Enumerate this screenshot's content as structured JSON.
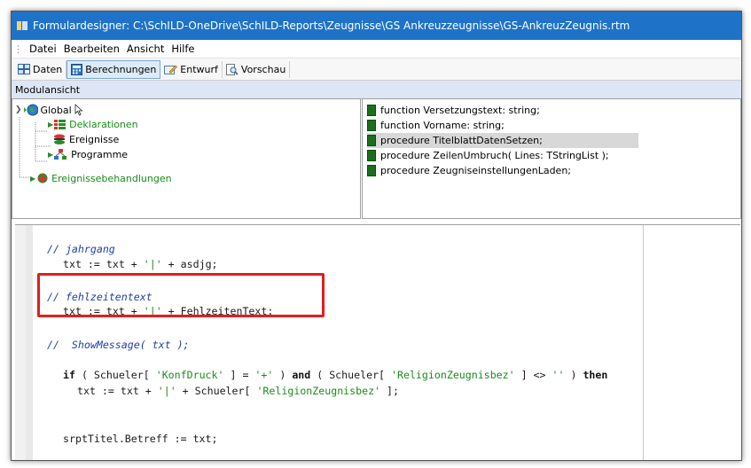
{
  "window": {
    "title": "Formulardesigner: C:\\SchILD-OneDrive\\SchILD-Reports\\Zeugnisse\\GS Ankreuzzeugnisse\\GS-AnkreuzZeugnis.rtm"
  },
  "menu": [
    "Datei",
    "Bearbeiten",
    "Ansicht",
    "Hilfe"
  ],
  "toolbar": {
    "tabs": [
      {
        "label": "Daten",
        "icon": "data-grid-icon"
      },
      {
        "label": "Berechnungen",
        "icon": "calculator-icon"
      },
      {
        "label": "Entwurf",
        "icon": "design-pencil-icon"
      },
      {
        "label": "Vorschau",
        "icon": "preview-magnifier-icon"
      }
    ]
  },
  "module_header": "Modulansicht",
  "tree": {
    "global": "Global",
    "deklarationen": "Deklarationen",
    "ereignisse": "Ereignisse",
    "programme": "Programme",
    "ereignisbehandlungen": "Ereignissebehandlungen"
  },
  "procedures": [
    "function Versetzungstext: string;",
    "function Vorname: string;",
    "procedure TitelblattDatenSetzen;",
    "procedure ZeilenUmbruch( Lines: TStringList );",
    "procedure ZeugniseinstellungenLaden;"
  ],
  "selected_procedure_index": 2,
  "code": {
    "l1_comment": "// jahrgang",
    "l2_a": "txt := txt + ",
    "l2_str": "'|'",
    "l2_b": " + asdjg;",
    "l3_comment": "// fehlzeitentext",
    "l4_a": "txt := txt + ",
    "l4_str": "'|'",
    "l4_b": " + FehlzeitenText;",
    "l5_comment": "//  ShowMessage( txt );",
    "l6_kw1": "if",
    "l6_a": " ( Schueler[ ",
    "l6_str1": "'KonfDruck'",
    "l6_b": " ] = ",
    "l6_str2": "'+'",
    "l6_c": " ) ",
    "l6_kw2": "and",
    "l6_d": " ( Schueler[ ",
    "l6_str3": "'ReligionZeugnisbez'",
    "l6_e": " ] <> ",
    "l6_str4": "''",
    "l6_f": " ) ",
    "l6_kw3": "then",
    "l7_a": "txt := txt + ",
    "l7_str1": "'|'",
    "l7_b": " + Schueler[ ",
    "l7_str2": "'ReligionZeugnisbez'",
    "l7_c": " ];",
    "l8": "srptTitel.Betreff := txt;"
  }
}
